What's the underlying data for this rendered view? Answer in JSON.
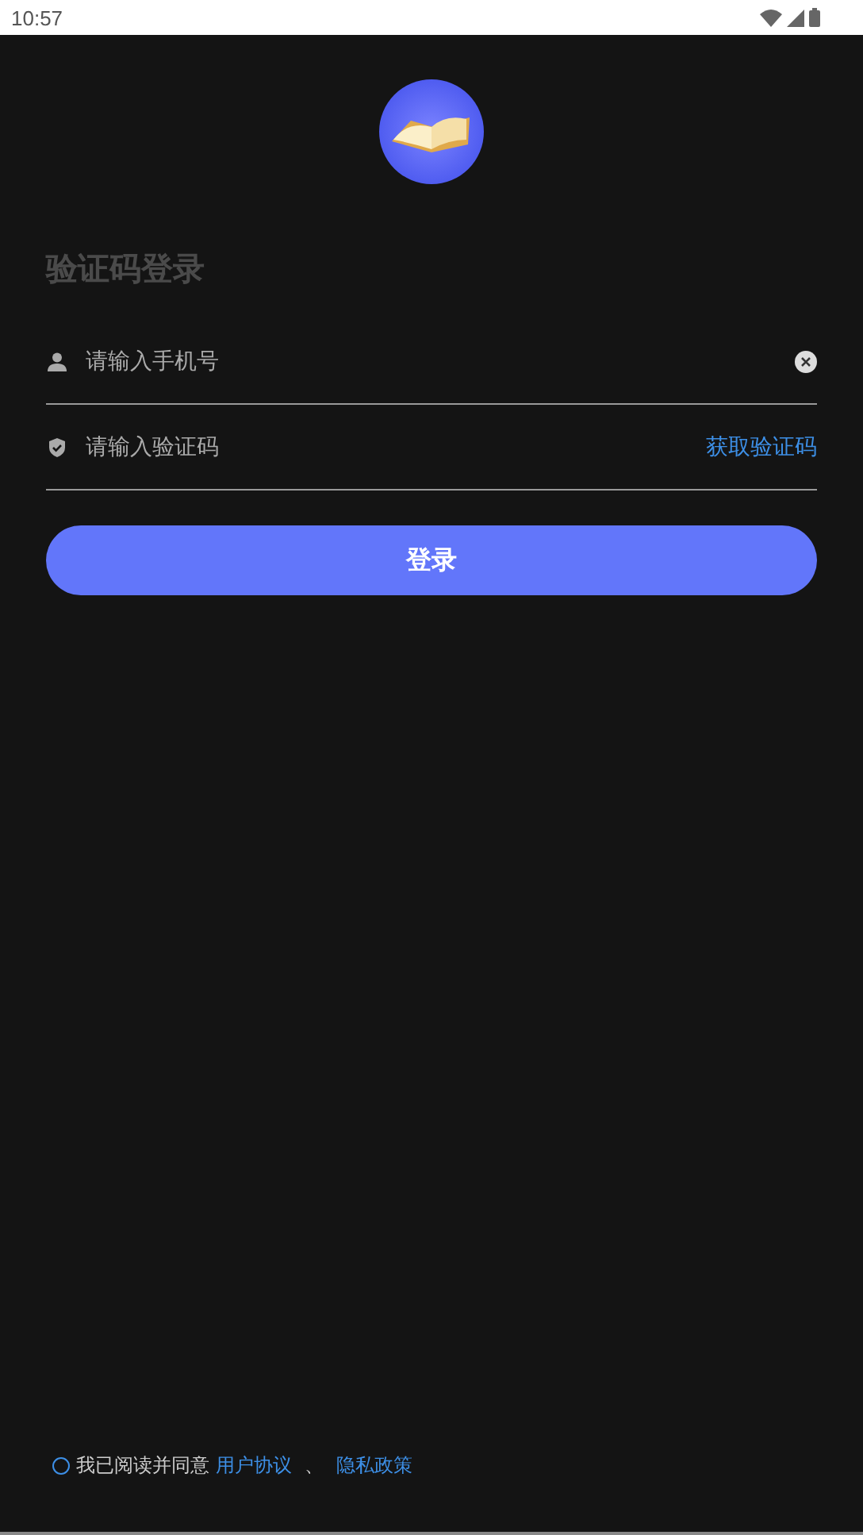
{
  "status_bar": {
    "time": "10:57"
  },
  "title": "验证码登录",
  "phone_field": {
    "placeholder": "请输入手机号"
  },
  "code_field": {
    "placeholder": "请输入验证码",
    "action": "获取验证码"
  },
  "login_button": "登录",
  "agreement": {
    "checked": false,
    "text": "我已阅读并同意",
    "links": [
      "用户协议",
      "隐私政策"
    ],
    "separator": "、"
  }
}
